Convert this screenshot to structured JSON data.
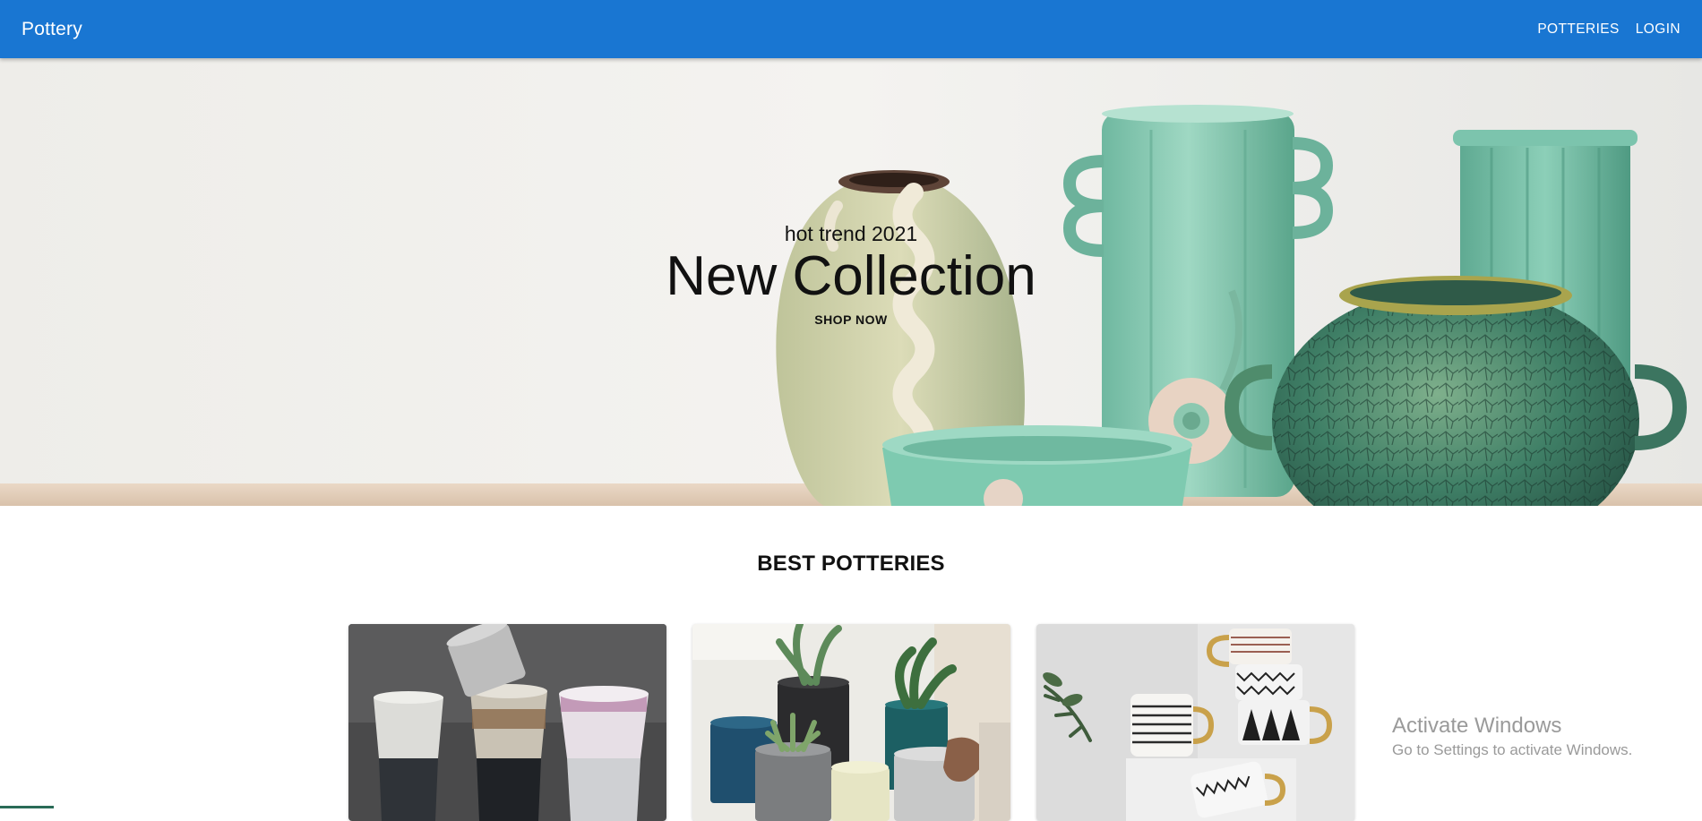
{
  "navbar": {
    "brand": "Pottery",
    "links": [
      {
        "label": "POTTERIES"
      },
      {
        "label": "LOGIN"
      }
    ],
    "background_color": "#1976d2"
  },
  "hero": {
    "subtitle": "hot trend 2021",
    "title": "New Collection",
    "cta_label": "SHOP NOW"
  },
  "best": {
    "heading": "BEST POTTERIES",
    "cards": [
      {
        "image": "stacked-ceramic-cups-photo"
      },
      {
        "image": "succulent-planters-photo"
      },
      {
        "image": "striped-mugs-photo"
      }
    ]
  },
  "os_watermark": {
    "title": "Activate Windows",
    "subtitle": "Go to Settings to activate Windows."
  }
}
